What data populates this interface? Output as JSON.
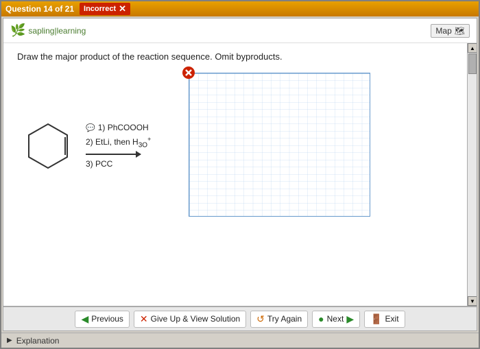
{
  "titleBar": {
    "questionLabel": "Question 14 of 21",
    "incorrectLabel": "Incorrect"
  },
  "header": {
    "logoLeaf": "🌿",
    "logoTextPart1": "sapling",
    "logoTextPart2": "learning",
    "mapLabel": "Map"
  },
  "question": {
    "text": "Draw the major product of the reaction sequence. Omit byproducts."
  },
  "reagents": {
    "step1": "1) PhCOOOH",
    "step2Prefix": "2) EtLi, then H",
    "step2Suffix": "3O",
    "step2Superscript": "+",
    "step3": "3) PCC"
  },
  "toolbar": {
    "previousLabel": "Previous",
    "giveUpLabel": "Give Up & View Solution",
    "tryAgainLabel": "Try Again",
    "nextLabel": "Next",
    "exitLabel": "Exit"
  },
  "statusBar": {
    "explanationLabel": "Explanation"
  },
  "colors": {
    "accent": "#e8a000",
    "incorrect": "#cc2200",
    "grid": "#aaccee"
  }
}
